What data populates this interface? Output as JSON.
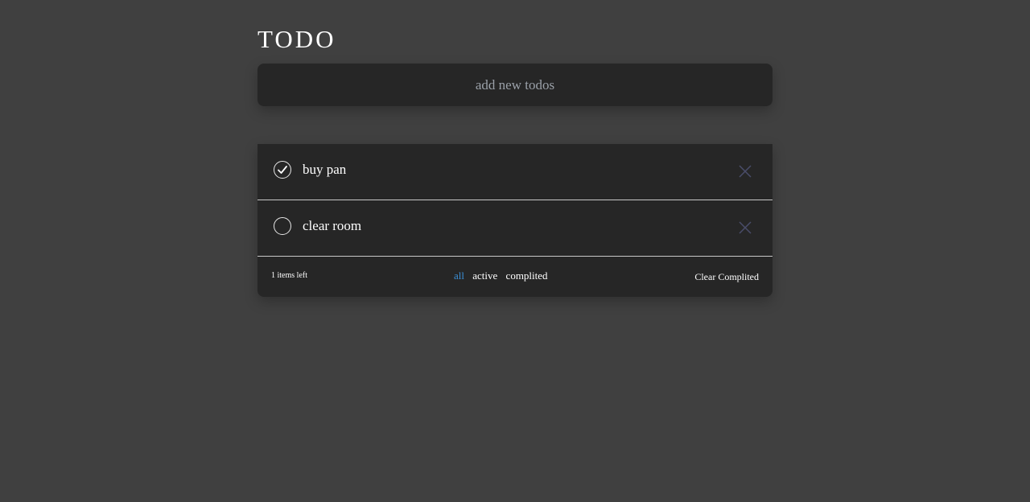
{
  "app": {
    "title": "TODO"
  },
  "new_todo": {
    "placeholder": "add new todos"
  },
  "todos": [
    {
      "text": "buy pan",
      "completed": true,
      "check_icon": "checkmark-circle-icon",
      "remove_icon": "close-icon"
    },
    {
      "text": "clear room",
      "completed": false,
      "check_icon": "empty-circle-icon",
      "remove_icon": "close-icon"
    }
  ],
  "footer": {
    "items_left": "1 items left",
    "filters": [
      {
        "label": "all",
        "selected": true
      },
      {
        "label": "active",
        "selected": false
      },
      {
        "label": "complited",
        "selected": false
      }
    ],
    "clear_label": "Clear Complited"
  },
  "colors": {
    "background": "#404040",
    "panel": "#262626",
    "accent": "#3b8fd6",
    "remove_icon": "#4a4d6a"
  }
}
